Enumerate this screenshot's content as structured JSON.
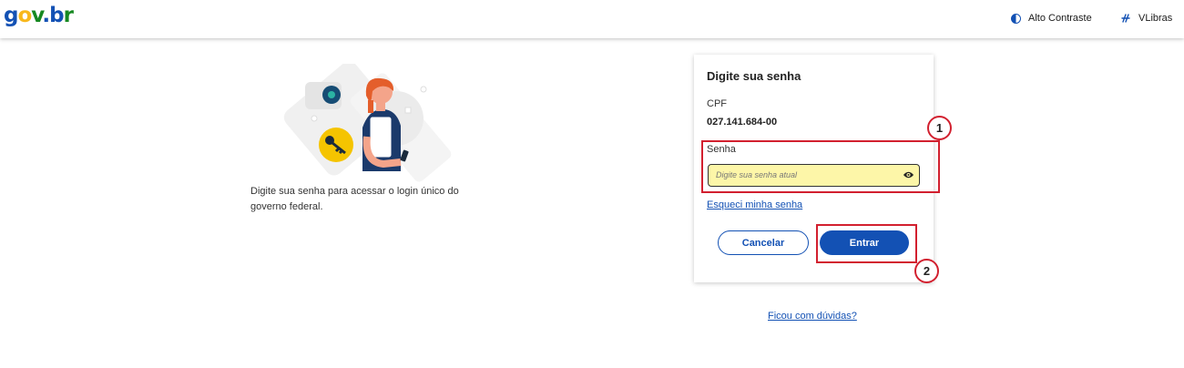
{
  "header": {
    "logo": {
      "g": "g",
      "o": "o",
      "v": "v",
      "dot": ".",
      "b": "b",
      "r": "r"
    },
    "high_contrast_label": "Alto Contraste",
    "vlibras_label": "VLibras"
  },
  "intro": {
    "text": "Digite sua senha para acessar o login único do governo federal."
  },
  "card": {
    "title": "Digite sua senha",
    "cpf_label": "CPF",
    "cpf_value": "027.141.684-00",
    "password_label": "Senha",
    "password_placeholder": "Digite sua senha atual",
    "forgot_link": "Esqueci minha senha",
    "cancel_label": "Cancelar",
    "submit_label": "Entrar"
  },
  "annotations": {
    "marker_1": "1",
    "marker_2": "2"
  },
  "help_link": "Ficou com dúvidas?",
  "colors": {
    "brand_blue": "#1351b4",
    "highlight_red": "#d2202f",
    "field_yellow": "#fdf6a8"
  }
}
